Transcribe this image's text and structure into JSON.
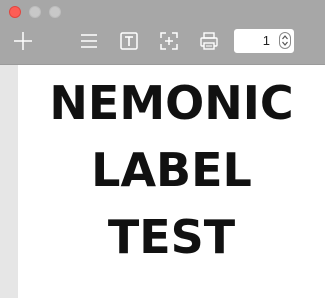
{
  "toolbar": {
    "items": [
      {
        "icon": "plus-icon"
      },
      {
        "icon": "menu-icon"
      },
      {
        "icon": "text-box-icon"
      },
      {
        "icon": "add-image-icon"
      },
      {
        "icon": "print-icon"
      }
    ],
    "page_number": "1"
  },
  "label": {
    "lines": [
      "NEMONIC",
      "LABEL",
      "TEST"
    ]
  },
  "colors": {
    "titlebar": "#a7a7a7",
    "close_button": "#fc5e56",
    "text": "#111111"
  }
}
